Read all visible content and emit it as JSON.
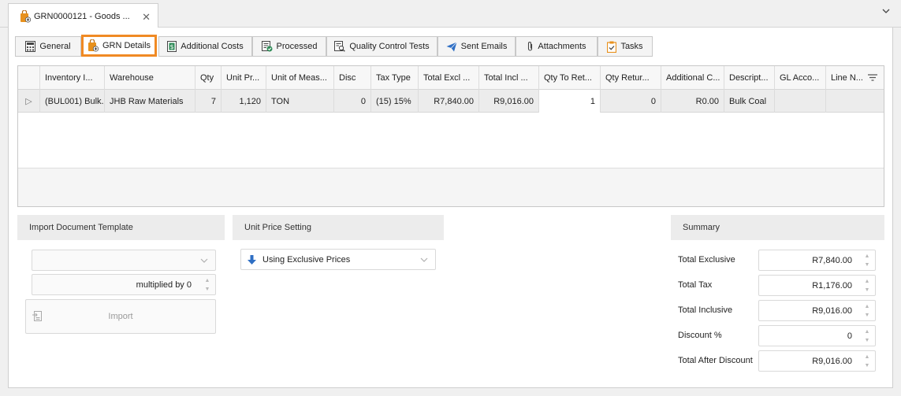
{
  "window": {
    "doc_tab_title": "GRN0000121 - Goods ...",
    "close_glyph": "✕",
    "collapse_glyph": "⌄"
  },
  "tabs": [
    {
      "label": "General",
      "icon": "calculator-icon"
    },
    {
      "label": "GRN Details",
      "icon": "bag-plus-icon",
      "active": true
    },
    {
      "label": "Additional Costs",
      "icon": "dollar-doc-icon"
    },
    {
      "label": "Processed",
      "icon": "check-doc-icon"
    },
    {
      "label": "Quality Control Tests",
      "icon": "search-doc-icon"
    },
    {
      "label": "Sent Emails",
      "icon": "paper-plane-icon"
    },
    {
      "label": "Attachments",
      "icon": "paperclip-icon"
    },
    {
      "label": "Tasks",
      "icon": "clipboard-check-icon"
    }
  ],
  "grid": {
    "columns": [
      "Inventory I...",
      "Warehouse",
      "Qty",
      "Unit Pr...",
      "Unit of Meas...",
      "Disc",
      "Tax Type",
      "Total Excl ...",
      "Total Incl ...",
      "Qty To Ret...",
      "Qty Retur...",
      "Additional C...",
      "Descript...",
      "GL Acco...",
      "Line N..."
    ],
    "row": {
      "expander": "▷",
      "inventory_item": "(BUL001) Bulk...",
      "warehouse": "JHB Raw Materials",
      "qty": "7",
      "unit_price": "1,120",
      "unit_of_measure": "TON",
      "disc": "0",
      "tax_type": "(15) 15%",
      "total_excl": "R7,840.00",
      "total_incl": "R9,016.00",
      "qty_to_return": "1",
      "qty_returned": "0",
      "additional_costs": "R0.00",
      "description": "Bulk Coal",
      "gl_account": "",
      "line_notes": ""
    }
  },
  "import_panel": {
    "header": "Import Document Template",
    "template_value": "",
    "multiplier_label": "multiplied by 0",
    "import_button": "Import"
  },
  "unit_price_panel": {
    "header": "Unit Price Setting",
    "selected": "Using Exclusive Prices"
  },
  "summary": {
    "header": "Summary",
    "total_exclusive_label": "Total Exclusive",
    "total_exclusive": "R7,840.00",
    "total_tax_label": "Total Tax",
    "total_tax": "R1,176.00",
    "total_inclusive_label": "Total Inclusive",
    "total_inclusive": "R9,016.00",
    "discount_label": "Discount %",
    "discount": "0",
    "total_after_discount_label": "Total After Discount",
    "total_after_discount": "R9,016.00"
  },
  "colors": {
    "active_tab_border": "#f08a24",
    "accent_blue": "#2f6fc4",
    "icon_orange": "#e8911d"
  }
}
